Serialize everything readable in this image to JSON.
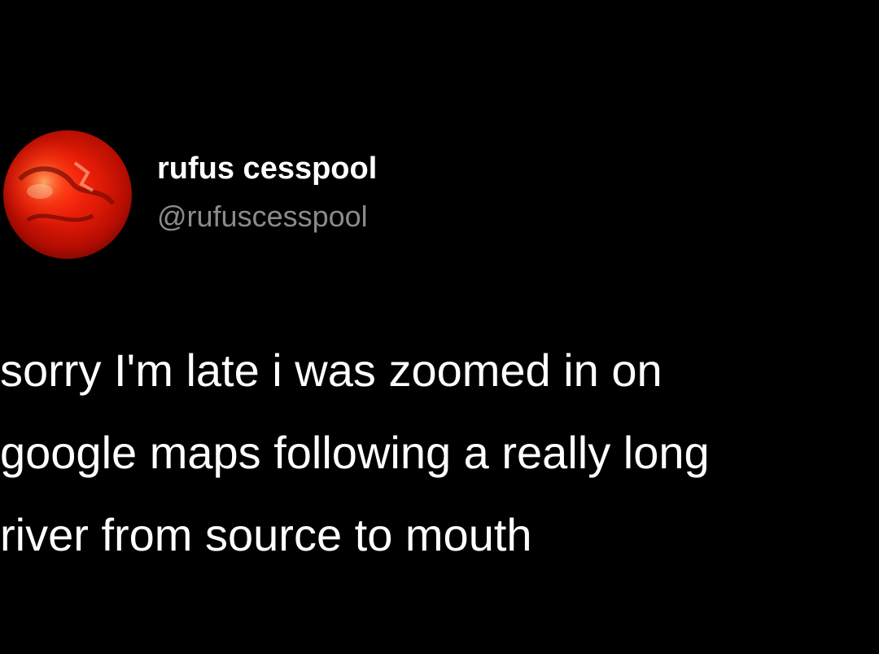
{
  "tweet": {
    "author": {
      "display_name": "rufus cesspool",
      "handle": "@rufuscesspool",
      "avatar_icon": "red-abstract-avatar"
    },
    "text_lines": [
      "sorry I'm late i was zoomed in on",
      "google maps following a really long",
      "river from source to mouth"
    ]
  },
  "colors": {
    "background": "#000000",
    "display_name": "#ffffff",
    "handle": "#8b8b8b",
    "body_text": "#ffffff",
    "avatar_red": "#e01b06"
  }
}
